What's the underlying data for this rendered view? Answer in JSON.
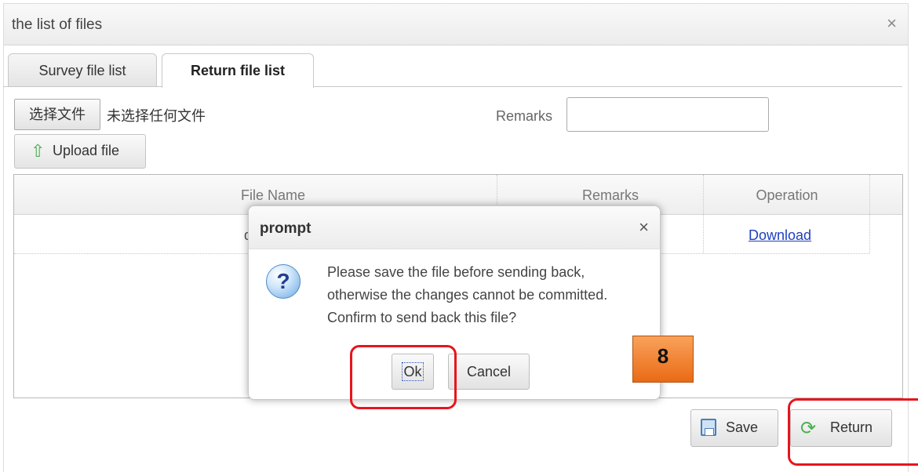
{
  "window": {
    "title": "the list of files",
    "close_glyph": "×"
  },
  "tabs": [
    {
      "label": "Survey file list",
      "active": false
    },
    {
      "label": "Return file list",
      "active": true
    }
  ],
  "upload_form": {
    "choose_file_label": "选择文件",
    "no_file_text": "未选择任何文件",
    "remarks_label": "Remarks",
    "remarks_value": "",
    "upload_button": "Upload file",
    "upload_icon": "up-arrow-icon"
  },
  "table": {
    "columns": [
      "File Name",
      "Remarks",
      "Operation"
    ],
    "rows": [
      {
        "file_name": "ddd",
        "remarks": "",
        "operation": "Download"
      }
    ]
  },
  "actions": {
    "save_label": "Save",
    "save_icon": "floppy-disk-icon",
    "return_label": "Return",
    "return_icon": "refresh-icon"
  },
  "dialog": {
    "title": "prompt",
    "close_glyph": "×",
    "icon": "question-icon",
    "icon_glyph": "?",
    "message": "Please save the file before sending back, otherwise the changes cannot be committed. Confirm to send back this file?",
    "ok_label": "Ok",
    "cancel_label": "Cancel"
  },
  "annotations": {
    "step_number": "8",
    "highlight_color": "#e8141d",
    "badge_color": "#ea6a15"
  }
}
